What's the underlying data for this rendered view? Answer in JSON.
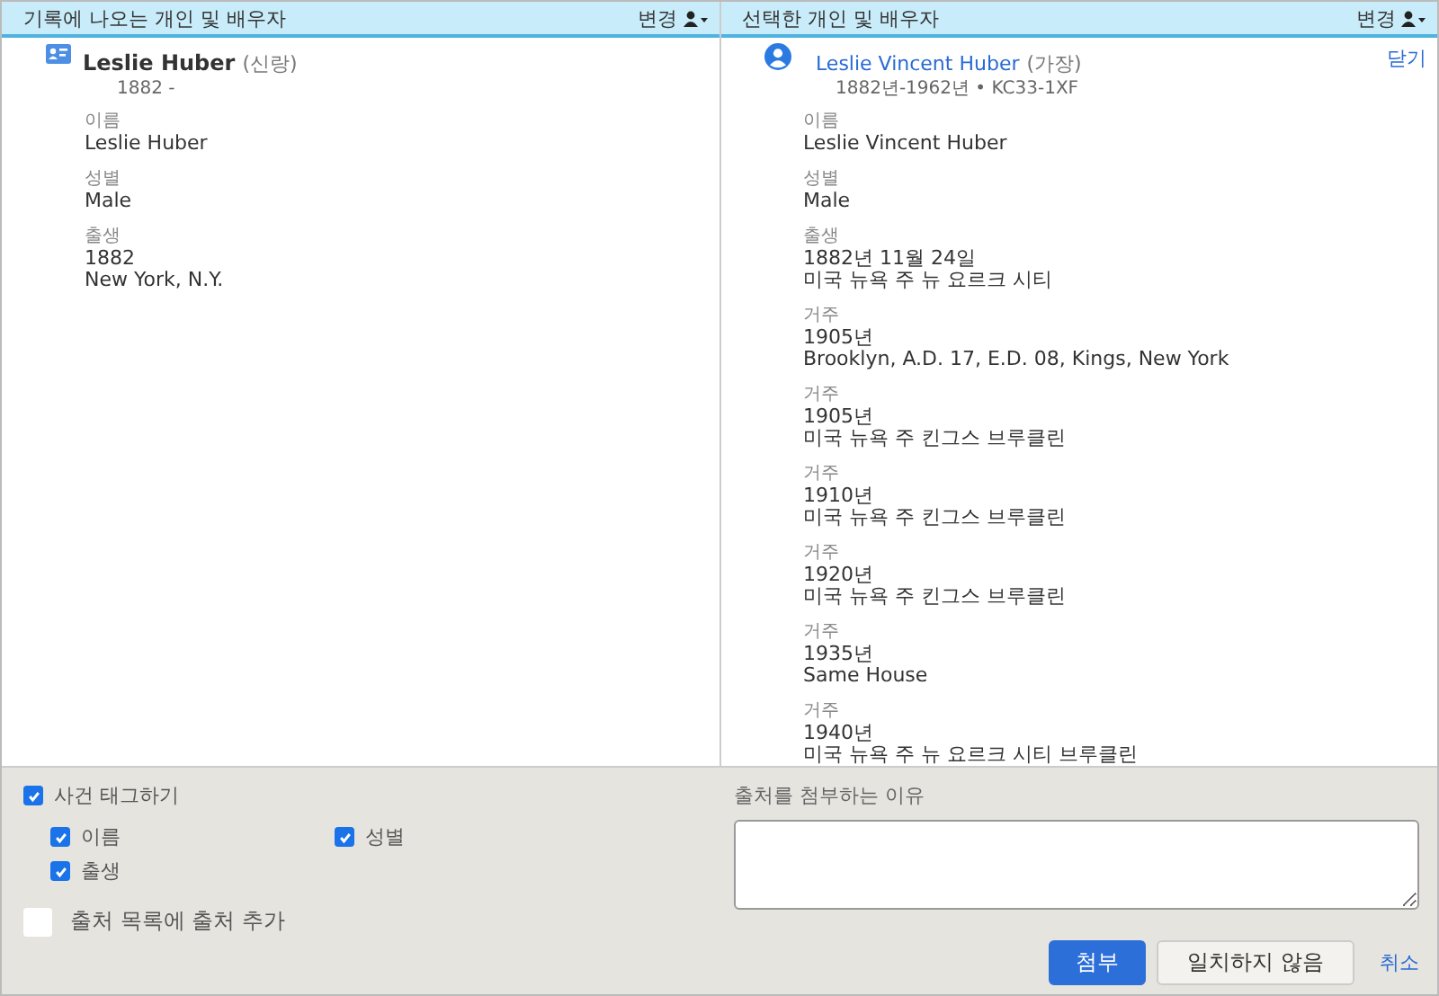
{
  "panels": [
    {
      "header": "기록에 나오는 개인 및 배우자",
      "change_label": "변경",
      "person": {
        "kind": "record",
        "name": "Leslie Huber",
        "role": "(신랑)",
        "dates": "1882 -"
      },
      "facts": [
        {
          "label": "이름",
          "lines": [
            "Leslie Huber"
          ]
        },
        {
          "label": "성별",
          "lines": [
            "Male"
          ]
        },
        {
          "label": "출생",
          "lines": [
            "1882",
            "New York, N.Y."
          ]
        }
      ]
    },
    {
      "header": "선택한 개인 및 배우자",
      "change_label": "변경",
      "close_label": "닫기",
      "person": {
        "kind": "tree",
        "name": "Leslie Vincent Huber",
        "role": "(가장)",
        "dates": "1882년-1962년 • KC33-1XF"
      },
      "facts": [
        {
          "label": "이름",
          "lines": [
            "Leslie Vincent Huber"
          ]
        },
        {
          "label": "성별",
          "lines": [
            "Male"
          ]
        },
        {
          "label": "출생",
          "lines": [
            "1882년 11월 24일",
            "미국 뉴욕 주 뉴 요르크 시티"
          ]
        },
        {
          "label": "거주",
          "lines": [
            "1905년",
            "Brooklyn, A.D. 17, E.D. 08, Kings, New York"
          ]
        },
        {
          "label": "거주",
          "lines": [
            "1905년",
            "미국 뉴욕 주 킨그스 브루클린"
          ]
        },
        {
          "label": "거주",
          "lines": [
            "1910년",
            "미국 뉴욕 주 킨그스 브루클린"
          ]
        },
        {
          "label": "거주",
          "lines": [
            "1920년",
            "미국 뉴욕 주 킨그스 브루클린"
          ]
        },
        {
          "label": "거주",
          "lines": [
            "1935년",
            "Same House"
          ]
        },
        {
          "label": "거주",
          "lines": [
            "1940년",
            "미국 뉴욕 주 뉴 요르크 시티 브루클린"
          ]
        }
      ]
    }
  ],
  "tag_events": {
    "label": "사건 태그하기",
    "checked": true,
    "items": [
      {
        "label": "이름",
        "checked": true
      },
      {
        "label": "성별",
        "checked": true
      },
      {
        "label": "출생",
        "checked": true
      }
    ]
  },
  "add_source": {
    "label": "출처 목록에 출처 추가",
    "checked": false
  },
  "reason": {
    "label": "출처를 첨부하는 이유"
  },
  "buttons": [
    {
      "kind": "primary",
      "label": "첨부"
    },
    {
      "kind": "secondary",
      "label": "일치하지 않음"
    },
    {
      "kind": "link",
      "label": "취소"
    }
  ]
}
